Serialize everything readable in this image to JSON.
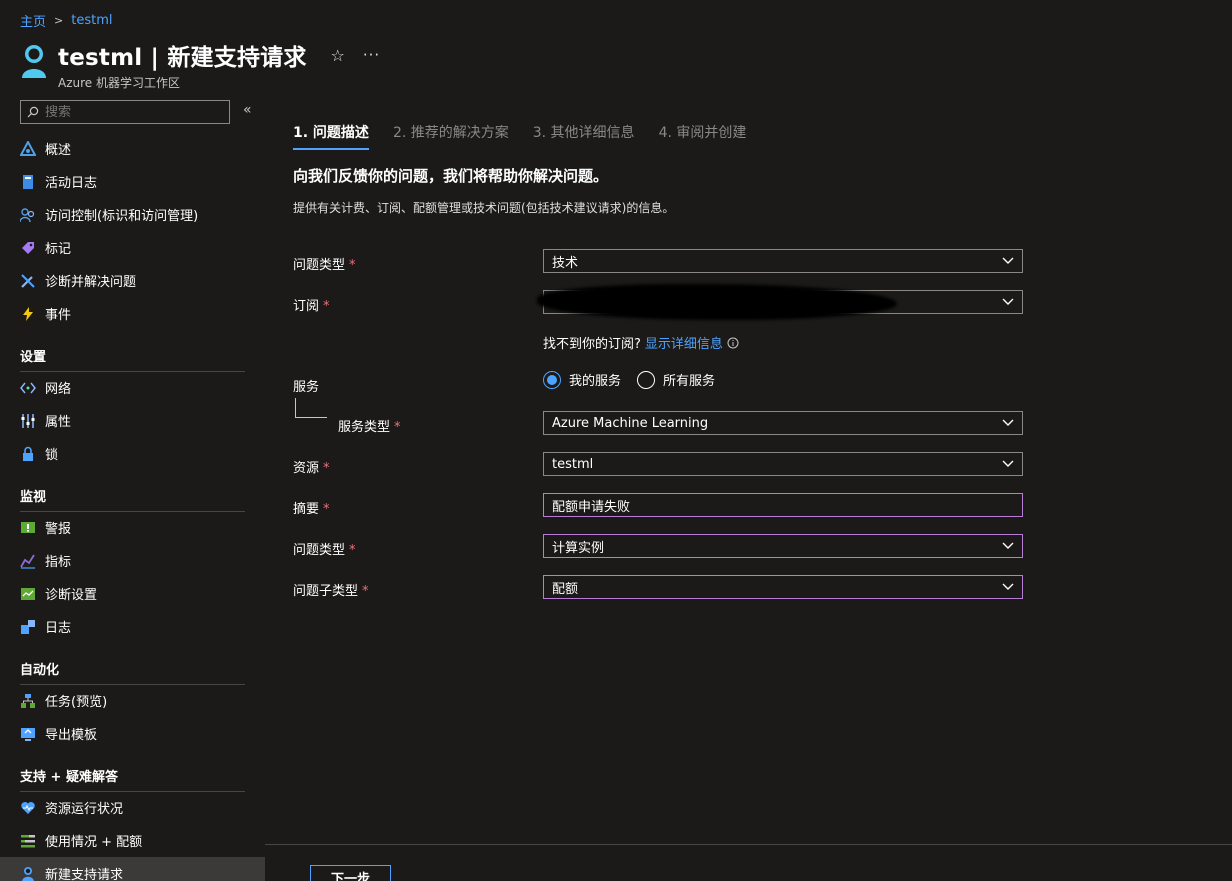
{
  "breadcrumb": {
    "home": "主页",
    "current": "testml"
  },
  "header": {
    "title": "testml | 新建支持请求",
    "subtitle": "Azure 机器学习工作区",
    "star_icon": "☆",
    "more_icon": "···"
  },
  "sidebar": {
    "search_placeholder": "搜索",
    "collapse_icon": "«",
    "items_top": [
      {
        "label": "概述",
        "icon": "overview-icon",
        "color": "#50a0e6"
      },
      {
        "label": "活动日志",
        "icon": "activity-log-icon",
        "color": "#3c8ce7"
      },
      {
        "label": "访问控制(标识和访问管理)",
        "icon": "iam-icon",
        "color": "#50a0e6"
      },
      {
        "label": "标记",
        "icon": "tag-icon",
        "color": "#a67af4"
      },
      {
        "label": "诊断并解决问题",
        "icon": "wrench-icon",
        "color": "#8ab4f8"
      },
      {
        "label": "事件",
        "icon": "lightning-icon",
        "color": "#f2c811"
      }
    ],
    "section_settings": "设置",
    "items_settings": [
      {
        "label": "网络",
        "icon": "network-icon",
        "color": "#50e6a0"
      },
      {
        "label": "属性",
        "icon": "properties-icon",
        "color": "#8ab4f8"
      },
      {
        "label": "锁",
        "icon": "lock-icon",
        "color": "#4da3ff"
      }
    ],
    "section_monitoring": "监视",
    "items_monitoring": [
      {
        "label": "警报",
        "icon": "alert-icon",
        "color": "#5ea836"
      },
      {
        "label": "指标",
        "icon": "metrics-icon",
        "color": "#8a6bd8"
      },
      {
        "label": "诊断设置",
        "icon": "diagnostic-settings-icon",
        "color": "#5ea836"
      },
      {
        "label": "日志",
        "icon": "logs-icon",
        "color": "#4da3ff"
      }
    ],
    "section_automation": "自动化",
    "items_automation": [
      {
        "label": "任务(预览)",
        "icon": "tasks-icon",
        "color": "#4da3ff"
      },
      {
        "label": "导出模板",
        "icon": "export-template-icon",
        "color": "#4da3ff"
      }
    ],
    "section_support": "支持 + 疑难解答",
    "items_support": [
      {
        "label": "资源运行状况",
        "icon": "heart-icon",
        "color": "#4da3ff"
      },
      {
        "label": "使用情况 + 配额",
        "icon": "usage-quota-icon",
        "color": "#5ea836"
      },
      {
        "label": "新建支持请求",
        "icon": "support-request-icon",
        "color": "#4da3ff"
      }
    ]
  },
  "wizard": {
    "tabs": [
      "1. 问题描述",
      "2. 推荐的解决方案",
      "3. 其他详细信息",
      "4. 审阅并创建"
    ],
    "heading": "向我们反馈你的问题，我们将帮助你解决问题。",
    "description": "提供有关计费、订阅、配额管理或技术问题(包括技术建议请求)的信息。",
    "fields": {
      "issue_type": {
        "label": "问题类型",
        "value": "技术"
      },
      "subscription": {
        "label": "订阅",
        "value": ""
      },
      "subscription_hint": "找不到你的订阅?",
      "subscription_link": "显示详细信息",
      "service_label": "服务",
      "service_radio_my": "我的服务",
      "service_radio_all": "所有服务",
      "service_type": {
        "label": "服务类型",
        "value": "Azure Machine Learning"
      },
      "resource": {
        "label": "资源",
        "value": "testml"
      },
      "summary": {
        "label": "摘要",
        "value": "配额申请失败"
      },
      "problem_type": {
        "label": "问题类型",
        "value": "计算实例"
      },
      "problem_subtype": {
        "label": "问题子类型",
        "value": "配额"
      }
    },
    "required_mark": "*",
    "next_button": "下一步"
  }
}
